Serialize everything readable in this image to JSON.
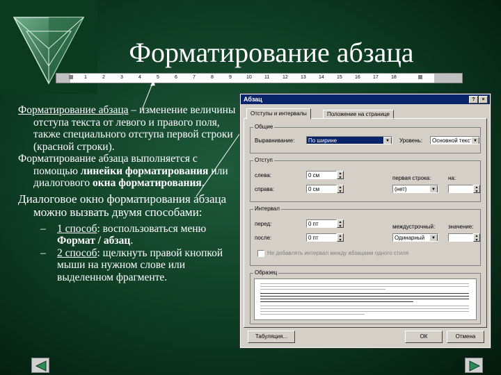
{
  "slide": {
    "title": "Форматирование абзаца"
  },
  "ruler": {
    "ticks": [
      "1",
      "2",
      "3",
      "4",
      "5",
      "6",
      "7",
      "8",
      "9",
      "10",
      "11",
      "12",
      "13",
      "14",
      "15",
      "16",
      "17",
      "18"
    ]
  },
  "content": {
    "para1_head": "Форматирование абзаца",
    "para1_rest": " – изменение величины отступа текста от левого и правого поля, также специального отступа первой строки (красной строки).",
    "para2_a": "Форматирование абзаца выполняется с помощью ",
    "para2_b": "линейки форматирования",
    "para2_c": " или диалогового ",
    "para2_d": "окна форматирования",
    "para2_e": ".",
    "para3": "Диалоговое окно форматирования абзаца можно вызвать двумя способами:",
    "bullet1_link": "1 способ",
    "bullet1_a": ": воспользоваться меню ",
    "bullet1_b": "Формат / абзац",
    "bullet1_c": ".",
    "bullet2_link": "2 способ",
    "bullet2_a": ": щелкнуть правой кнопкой мыши на нужном слове или выделенном фрагменте.",
    "dash": "–"
  },
  "dialog": {
    "title": "Абзац",
    "help_btn": "?",
    "close_btn": "×",
    "tabs": [
      "Отступы и интервалы",
      "Положение на странице"
    ],
    "group_general": "Общие",
    "alignment_label": "Выравнивание:",
    "alignment_value": "По ширине",
    "level_label": "Уровень:",
    "level_value": "Основной текст",
    "group_indent": "Отступ",
    "left_label": "слева:",
    "left_value": "0 см",
    "right_label": "справа:",
    "right_value": "0 см",
    "first_line_label": "первая строка:",
    "first_line_value": "(нет)",
    "by_label": "на:",
    "by_value": "",
    "group_spacing": "Интервал",
    "before_label": "перед:",
    "before_value": "0 пт",
    "after_label": "после:",
    "after_value": "0 пт",
    "line_spacing_label": "междустрочный:",
    "line_spacing_value": "Одинарный",
    "value_label": "значение:",
    "value_value": "",
    "no_space_label": "Не добавлять интервал между абзацами одного стиля",
    "group_sample": "Образец",
    "tabs_button": "Табуляция...",
    "ok_button": "ОК",
    "cancel_button": "Отмена"
  },
  "colors": {
    "background": "#0d3a22",
    "dialog_title_bar": "#0a246a",
    "dialog_face": "#d4d0c8"
  },
  "icons": [
    "back-arrow-icon",
    "forward-arrow-icon",
    "logo-triangle-icon"
  ]
}
